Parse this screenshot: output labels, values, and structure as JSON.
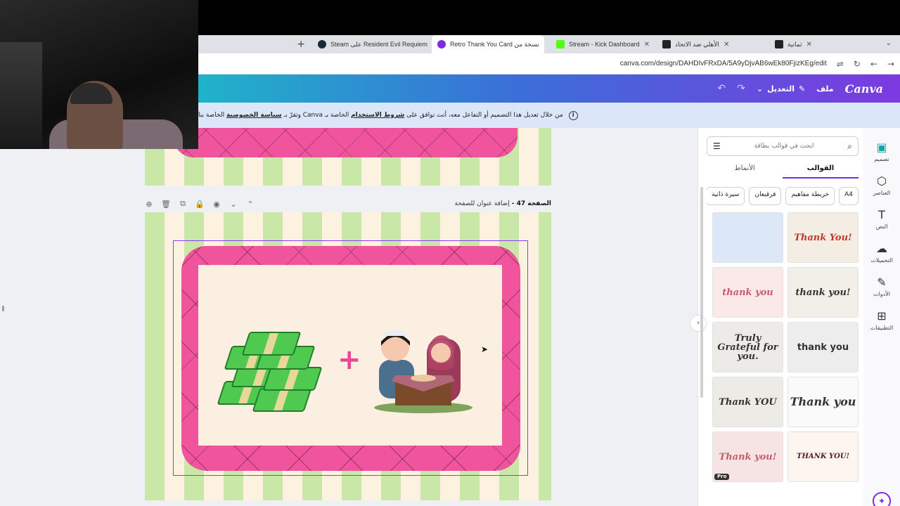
{
  "browser": {
    "tabs": [
      {
        "title": "ثمانية",
        "favicon_color": "#222222",
        "active": false
      },
      {
        "title": "الأهلي ضد الاتحاد",
        "favicon_color": "#222222",
        "active": false
      },
      {
        "title": "Stream - Kick Dashboard",
        "favicon_color": "#53fc18",
        "active": false
      },
      {
        "title": "نسخة من Retro Thank You Card",
        "favicon_color": "#7d2ae8",
        "active": true
      },
      {
        "title": "Resident Evil Requiem على Steam",
        "favicon_color": "#1b2838",
        "active": false
      }
    ],
    "new_tab": "+",
    "url": "canva.com/design/DAHDIvFRxDA/5A9yDjvAB6wEk80FjizKEg/edit"
  },
  "header": {
    "logo": "Canva",
    "file_label": "ملف",
    "edit_label": "التعديل",
    "undo": "↶",
    "redo": "↷"
  },
  "notice": {
    "prefix": "من خلال تعديل هذا التصميم أو التفاعل معه، أنت توافق على",
    "terms": "شروط الاستخدام",
    "middle": "الخاصة بـ Canva وتقرّ بـ",
    "privacy": "سياسة الخصوصية",
    "suffix": "الخاصة بنا"
  },
  "page": {
    "number_label": "الصفحة 47 -",
    "add_title": "إضافة عنوان للصفحة"
  },
  "panel": {
    "search_placeholder": "ابحث في قوالب بطاقة",
    "tabs": [
      {
        "label": "القوالب",
        "active": true
      },
      {
        "label": "الأنماط",
        "active": false
      }
    ],
    "chips": [
      "A4",
      "خريطة مفاهيم",
      "قرقيعان",
      "سيرة ذاتية"
    ],
    "thumbnails": [
      {
        "text": "",
        "bg": "#dce8f7"
      },
      {
        "text": "Thank You!",
        "bg": "#f4ede3"
      },
      {
        "text": "thank you",
        "bg": "#fbe9ea"
      },
      {
        "text": "thank you!",
        "bg": "#f1efe8"
      },
      {
        "text": "Truly Grateful for you.",
        "bg": "#ecebe8"
      },
      {
        "text": "thank you",
        "bg": "#ededed"
      },
      {
        "text": "Thank YOU",
        "bg": "#ecebe6"
      },
      {
        "text": "Thank you",
        "bg": "#fafafa"
      },
      {
        "text": "Thank you!",
        "bg": "#f6e4e4",
        "pro": "Pro"
      },
      {
        "text": "THANK YOU!",
        "bg": "#fdf6ef"
      }
    ]
  },
  "rail": [
    {
      "label": "تصميم",
      "icon": "▣",
      "active": true
    },
    {
      "label": "العناصر",
      "icon": "⬡",
      "active": false
    },
    {
      "label": "النص",
      "icon": "T",
      "active": false
    },
    {
      "label": "التحميلات",
      "icon": "☁",
      "active": false
    },
    {
      "label": "الأدوات",
      "icon": "✎",
      "active": false
    },
    {
      "label": "التطبيقات",
      "icon": "⊞",
      "active": false
    }
  ]
}
